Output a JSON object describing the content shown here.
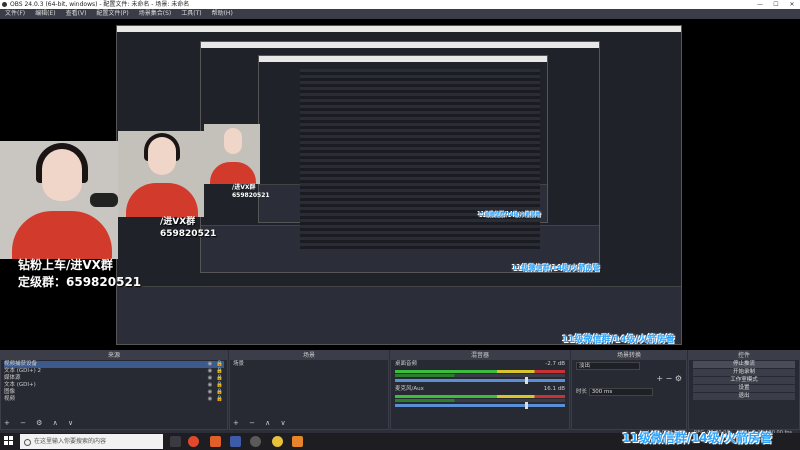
{
  "window": {
    "title": "OBS 24.0.3 (64-bit, windows) - 配置文件: 未命名 - 场景: 未命名",
    "controls": [
      "—",
      "☐",
      "✕"
    ]
  },
  "menu": [
    "文件(F)",
    "编辑(E)",
    "查看(V)",
    "配置文件(P)",
    "场景集合(S)",
    "工具(T)",
    "帮助(H)"
  ],
  "preview": {
    "caption_line1": "钻粉上车/进VX群",
    "caption_line2": "定级群：659820521",
    "caption_small_1": "/进VX群",
    "caption_small_2": "659820521",
    "caption_tiny_1": "/进VX群",
    "caption_tiny_2": "659820521",
    "overlay_text": "11级微信群/14级/火箭房管"
  },
  "docks": {
    "sources": {
      "title": "来源",
      "items": [
        "视频捕获设备",
        "文本 (GDI+) 2",
        "媒体源",
        "文本 (GDI+)",
        "图像",
        "视频"
      ],
      "tools": "+ − ⚙ ∧ ∨"
    },
    "scenes": {
      "title": "场景",
      "items": [
        "场景"
      ],
      "tools": "+ − ∧ ∨"
    },
    "mixer": {
      "title": "混音器",
      "channels": [
        {
          "name": "桌面音频",
          "db": "-2.7 dB"
        },
        {
          "name": "麦克风/Aux",
          "db": "16.1 dB"
        }
      ]
    },
    "transitions": {
      "title": "场景转换",
      "type": "淡出",
      "duration_label": "时长",
      "duration_value": "300 ms"
    },
    "controls": {
      "title": "控件",
      "buttons": [
        "停止推流",
        "开始录制",
        "工作室模式",
        "设置",
        "退出"
      ]
    }
  },
  "status": {
    "live": "LIVE: 00:47:28",
    "rec": "REC: 00:00:00",
    "cpu": "CPU: 5.1%, 30.00 fps"
  },
  "taskbar": {
    "search_placeholder": "在这里输入你要搜索的内容"
  },
  "colors": {
    "accent_blue": "#2aa3ff",
    "shirt_red": "#d23a2c",
    "meter_green": "#3cbe3c"
  }
}
